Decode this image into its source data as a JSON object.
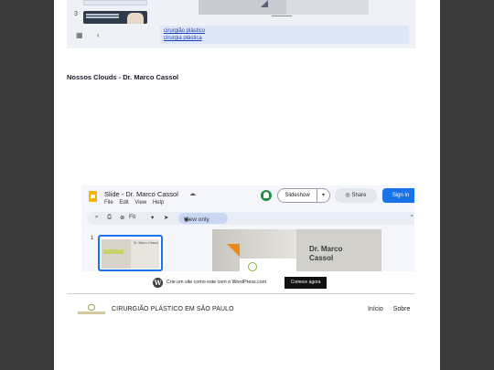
{
  "top_embed": {
    "slide_number": "3",
    "links": [
      "cirurgião plástico",
      "cirurgia plástica"
    ],
    "grid_icon": "grid-icon",
    "back_icon": "chevron-left-icon"
  },
  "section": {
    "title": "Nossos Clouds - Dr. Marco Cassol"
  },
  "slides_embed": {
    "doc_title": "Slide - Dr. Marco Cassol",
    "menu": [
      "File",
      "Edit",
      "View",
      "Help"
    ],
    "slideshow_label": "Slideshow",
    "share_label": "Share",
    "signin_label": "Sign in",
    "zoom_label": "Fit",
    "view_only_label": "View only",
    "slide_number": "1",
    "slide_name": "Dr. Marco\nCassol",
    "thumb_name": "Dr. Marco Cassol"
  },
  "wordpress_banner": {
    "text": "Crie um site como este com o WordPress.com",
    "button_label": "Comece agora"
  },
  "footer": {
    "site_name": "CIRURGIÃO PLÁSTICO EM SÃO PAULO",
    "nav": [
      "Início",
      "Sobre"
    ]
  },
  "colors": {
    "background": "#3a3a3a",
    "page": "#ffffff",
    "link": "#1a3fbf",
    "signin": "#1a73e8",
    "accent_orange": "#e98a1a"
  }
}
